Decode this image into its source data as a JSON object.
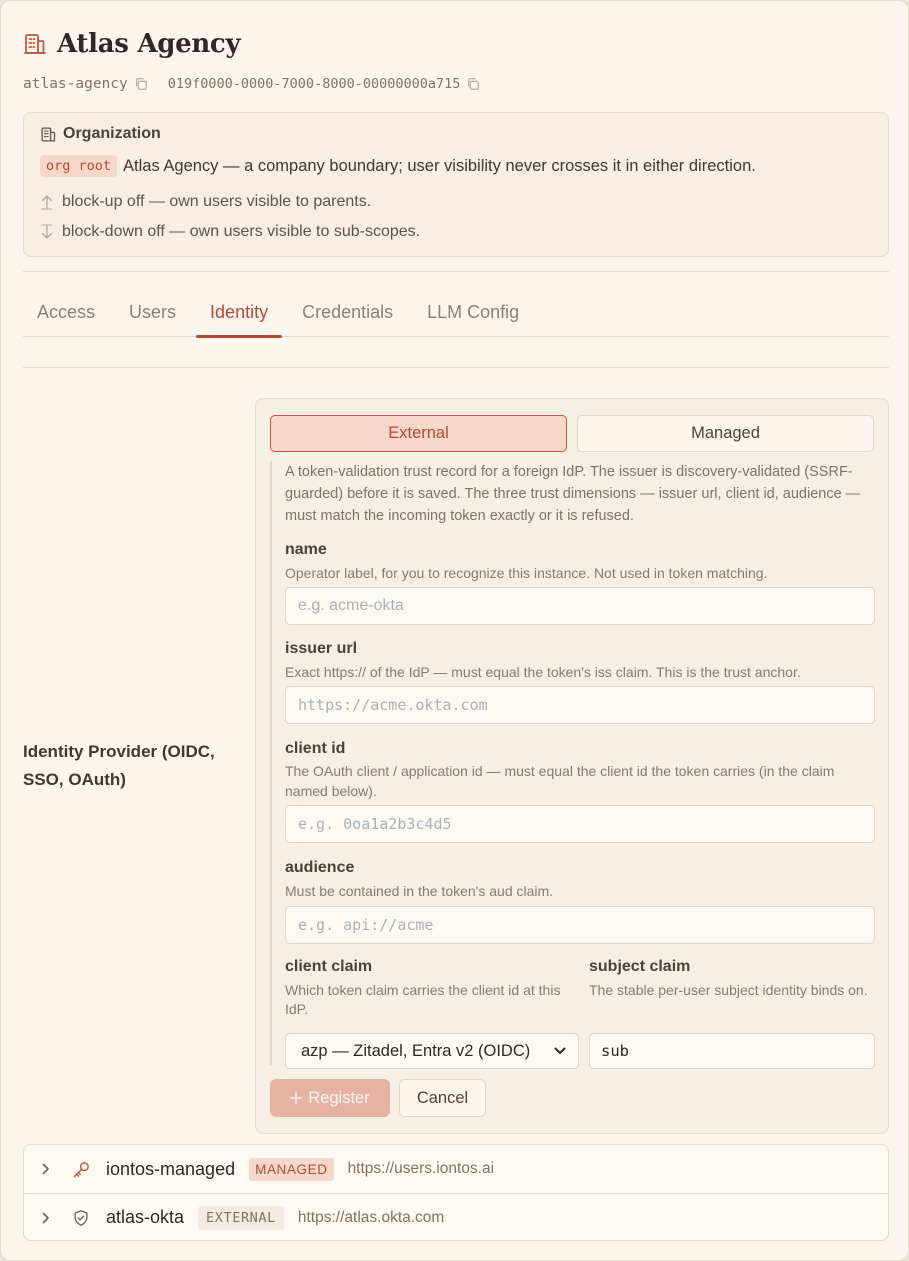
{
  "header": {
    "title": "Atlas Agency",
    "slug": "atlas-agency",
    "uuid": "019f0000-0000-7000-8000-00000000a715"
  },
  "org_card": {
    "heading": "Organization",
    "badge": "org root",
    "description": "Atlas Agency — a company boundary; user visibility never crosses it in either direction.",
    "block_up": "block-up off — own users visible to parents.",
    "block_down": "block-down off — own users visible to sub-scopes."
  },
  "tabs": [
    {
      "label": "Access"
    },
    {
      "label": "Users"
    },
    {
      "label": "Identity",
      "active": true
    },
    {
      "label": "Credentials"
    },
    {
      "label": "LLM Config"
    }
  ],
  "section_label": "Identity Provider (OIDC, SSO, OAuth)",
  "mode_toggle": {
    "external": "External",
    "managed": "Managed",
    "selected": "External"
  },
  "form": {
    "description": "A token-validation trust record for a foreign IdP. The issuer is discovery-validated (SSRF-guarded) before it is saved. The three trust dimensions — issuer url, client id, audience — must match the incoming token exactly or it is refused.",
    "name": {
      "label": "name",
      "help": "Operator label, for you to recognize this instance. Not used in token matching.",
      "placeholder": "e.g. acme-okta"
    },
    "issuer_url": {
      "label": "issuer url",
      "help": "Exact https:// of the IdP — must equal the token's iss claim. This is the trust anchor.",
      "placeholder": "https://acme.okta.com"
    },
    "client_id": {
      "label": "client id",
      "help": "The OAuth client / application id — must equal the client id the token carries (in the claim named below).",
      "placeholder": "e.g. 0oa1a2b3c4d5"
    },
    "audience": {
      "label": "audience",
      "help": "Must be contained in the token's aud claim.",
      "placeholder": "e.g. api://acme"
    },
    "client_claim": {
      "label": "client claim",
      "help": "Which token claim carries the client id at this IdP.",
      "value": "azp — Zitadel, Entra v2 (OIDC)"
    },
    "subject_claim": {
      "label": "subject claim",
      "help": "The stable per-user subject identity binds on.",
      "value": "sub"
    },
    "register_label": "Register",
    "cancel_label": "Cancel"
  },
  "providers": [
    {
      "name": "iontos-managed",
      "kind": "MANAGED",
      "url": "https://users.iontos.ai"
    },
    {
      "name": "atlas-okta",
      "kind": "EXTERNAL",
      "url": "https://atlas.okta.com"
    }
  ],
  "colors": {
    "accent": "#b94a32",
    "background": "#fbf7ee",
    "panel": "#f6efe3",
    "badge_bg": "#f6d8cb"
  }
}
